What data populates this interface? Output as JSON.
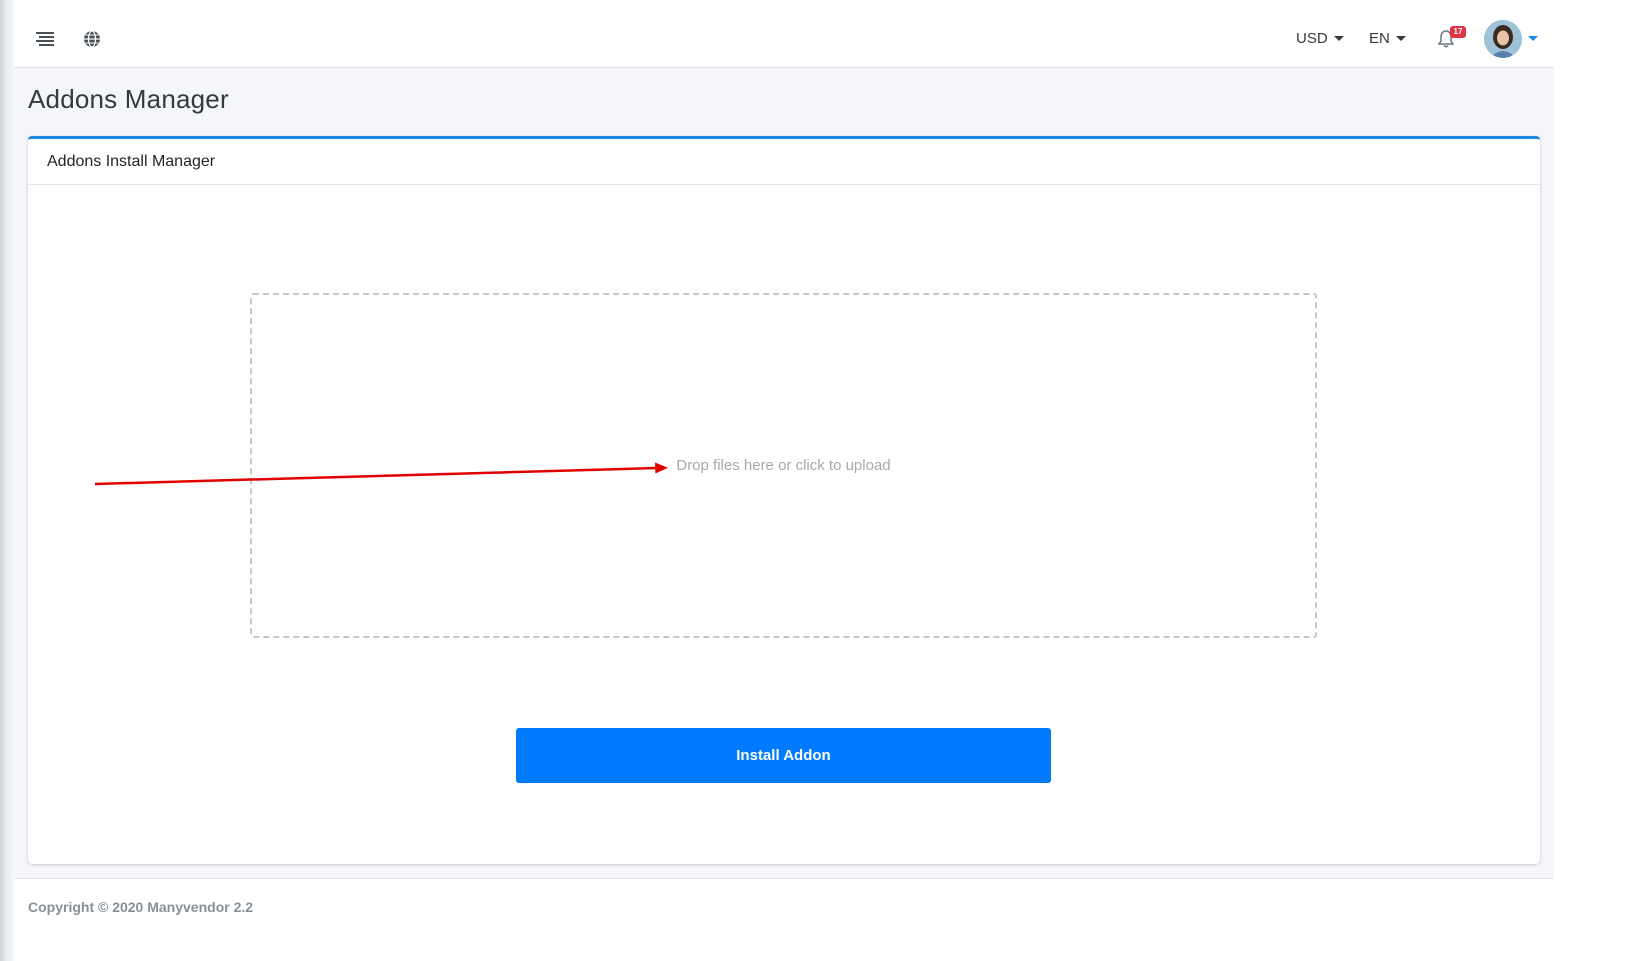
{
  "navbar": {
    "menu_icon": "hamburger-menu-icon",
    "globe_icon": "globe-icon",
    "currency": "USD",
    "language": "EN",
    "notification_count": "17",
    "bell_icon": "bell-icon"
  },
  "page": {
    "title": "Addons Manager"
  },
  "card": {
    "header": "Addons Install Manager",
    "dropzone_text": "Drop files here or click to upload",
    "install_button": "Install Addon",
    "accent_color": "#1e88e5",
    "button_color": "#007bff"
  },
  "annotation": {
    "arrow_color": "#e00000"
  },
  "footer": {
    "copyright": "Copyright © 2020 Manyvendor 2.2"
  }
}
